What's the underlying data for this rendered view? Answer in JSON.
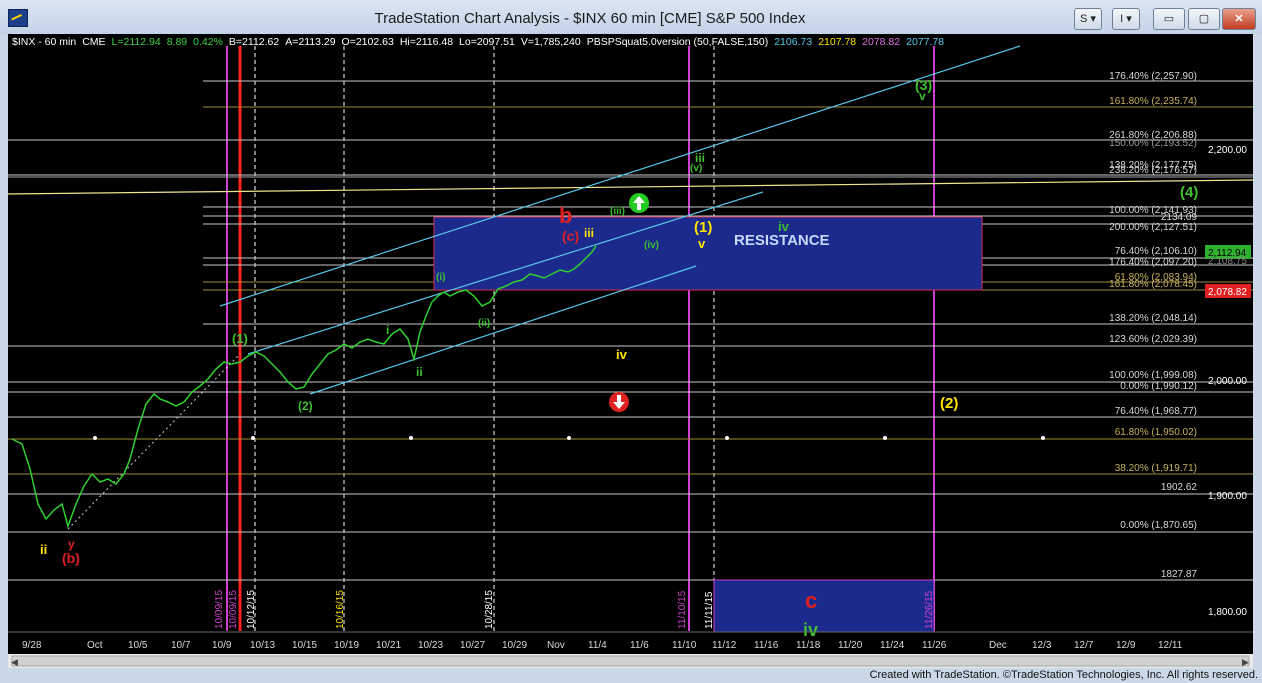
{
  "window": {
    "title": "TradeStation Chart Analysis - $INX 60 min [CME] S&P 500 Index",
    "btn_s": "S",
    "btn_i": "I",
    "btn_min": "▭",
    "btn_max": "▢",
    "btn_close": "✕"
  },
  "header": {
    "symbol": "$INX - 60 min",
    "exchange": "CME",
    "last": "L=2112.94",
    "change": "8.89",
    "pct": "0.42%",
    "bid": "B=2112.62",
    "ask": "A=2113.29",
    "open": "O=2102.63",
    "hi": "Hi=2116.48",
    "lo": "Lo=2097.51",
    "vol": "V=1,785,240",
    "indicator": "PBSPSquat5.0version (50,FALSE,150)",
    "ind_v1": "2106.73",
    "ind_v2": "2107.78",
    "ind_v3": "2078.82",
    "ind_v4": "2077.78"
  },
  "price_axis": [
    "2,200.00",
    "2,000.00",
    "1,900.00",
    "1,800.00"
  ],
  "price_tags": {
    "last": "2,112.94",
    "low_tag": "2,078.82",
    "hidden": "2,108.75"
  },
  "fib_labels": [
    "176.40% (2,257.90)",
    "161.80% (2,235.74)",
    "261.80% (2,206.88)",
    "150.00% (2,193.52)",
    "138.20% (2,177.75)",
    "238.20% (2,176.57)",
    "100.00% (2,141.93)",
    "2134.09",
    "200.00% (2,127.51)",
    "76.40% (2,106.10)",
    "176.40% (2,097.20)",
    "61.80% (2,083.94)",
    "161.80% (2,078.45)",
    "138.20% (2,048.14)",
    "123.60% (2,029.39)",
    "100.00% (1,999.08)",
    "0.00% (1,990.12)",
    "76.40% (1,968.77)",
    "61.80% (1,950.02)",
    "38.20% (1,919.71)",
    "1902.62",
    "0.00% (1,870.65)",
    "1827.87"
  ],
  "date_axis": [
    "9/28",
    "Oct",
    "10/5",
    "10/7",
    "10/9",
    "10/13",
    "10/15",
    "10/19",
    "10/21",
    "10/23",
    "10/27",
    "10/29",
    "Nov",
    "11/4",
    "11/6",
    "11/10",
    "11/12",
    "11/16",
    "11/18",
    "11/20",
    "11/24",
    "11/26",
    "Dec",
    "12/3",
    "12/7",
    "12/9",
    "12/11"
  ],
  "vline_dates": [
    "10/09/15",
    "10/09/15",
    "10/12/15",
    "10/16/15",
    "10/28/15",
    "11/10/15",
    "11/11/15",
    "11/26/15"
  ],
  "wave_labels": {
    "ii_low": "ii",
    "y": "y",
    "b_paren": "(b)",
    "w1": "(1)",
    "w2": "(2)",
    "i": "i",
    "ii": "ii",
    "wi": "(i)",
    "wii": "(ii)",
    "wiii": "(iii)",
    "wiv": "(iv)",
    "wv": "(v)",
    "b": "b",
    "c_paren": "(c)",
    "iii_y": "iii",
    "iii_g": "iii",
    "iv_y": "iv",
    "one_y": "(1)",
    "v_y": "v",
    "iv_g": "iv",
    "three_g": "(3)",
    "v_g": "v",
    "four_g": "(4)",
    "two_y": "(2)",
    "c_red": "c",
    "iv_bottom": "iv"
  },
  "resistance": "RESISTANCE",
  "footer": "Created with TradeStation. ©TradeStation Technologies, Inc. All rights reserved.",
  "colors": {
    "green": "#3fbf2f",
    "yellow": "#ffe400",
    "red": "#e02020",
    "magenta": "#d040d0",
    "cyan": "#58c8e8",
    "box": "#1b2a8c"
  }
}
